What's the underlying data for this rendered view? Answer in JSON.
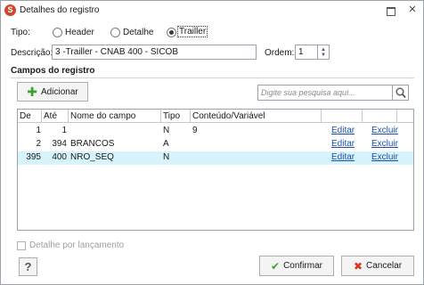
{
  "window": {
    "title": "Detalhes do registro",
    "icon_letter": "S"
  },
  "tipo": {
    "label": "Tipo:",
    "options": [
      "Header",
      "Detalhe",
      "Trailler"
    ],
    "selected": "Trailler"
  },
  "descricao": {
    "label": "Descrição:",
    "value": "3 -Trailler - CNAB 400 - SICOB"
  },
  "ordem": {
    "label": "Ordem:",
    "value": "1"
  },
  "campos": {
    "section_title": "Campos do registro",
    "add_label": "Adicionar",
    "search_placeholder": "Digite sua pesquisa aqui...",
    "columns": [
      "De",
      "Até",
      "Nome do campo",
      "Tipo",
      "Conteúdo/Variável",
      "",
      ""
    ],
    "rows": [
      {
        "de": "1",
        "ate": "1",
        "nome": "",
        "tipo": "N",
        "conteudo": "9",
        "editar": "Editar",
        "excluir": "Excluir",
        "selected": false
      },
      {
        "de": "2",
        "ate": "394",
        "nome": "BRANCOS",
        "tipo": "A",
        "conteudo": "",
        "editar": "Editar",
        "excluir": "Excluir",
        "selected": false
      },
      {
        "de": "395",
        "ate": "400",
        "nome": "NRO_SEQ",
        "tipo": "N",
        "conteudo": "",
        "editar": "Editar",
        "excluir": "Excluir",
        "selected": true
      }
    ]
  },
  "detalhe_lancamento": {
    "label": "Detalhe por lançamento",
    "checked": false
  },
  "footer": {
    "help_label": "?",
    "confirm_label": "Confirmar",
    "cancel_label": "Cancelar"
  },
  "icons": {
    "app": "app-logo-icon",
    "add": "plus-icon",
    "search": "search-icon",
    "confirm": "check-icon",
    "cancel": "x-icon"
  },
  "colors": {
    "selected_row": "#d7f3fb",
    "link": "#1a4fb0",
    "add_green": "#3aa52b",
    "cancel_red": "#d6361f"
  }
}
